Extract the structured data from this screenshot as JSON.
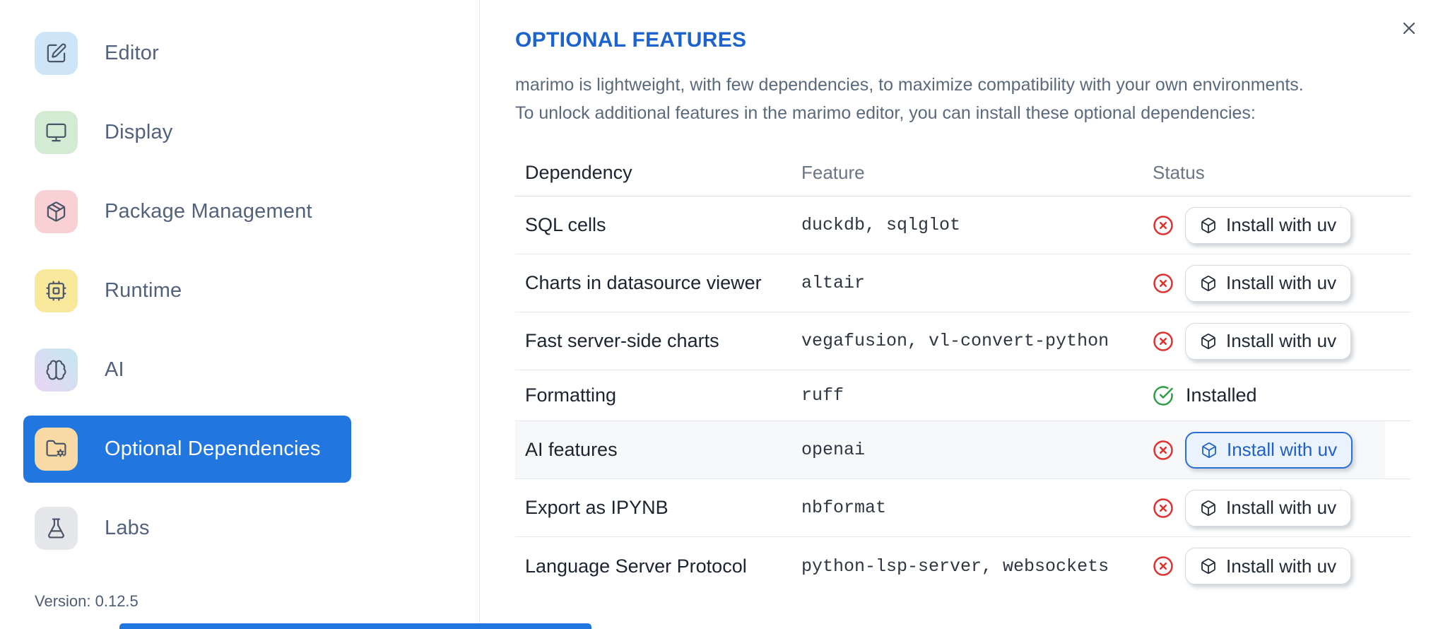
{
  "sidebar": {
    "items": [
      {
        "label": "Editor",
        "icon": "square-pen-icon",
        "icon_bg": "#cde5f7",
        "selected": false
      },
      {
        "label": "Display",
        "icon": "monitor-icon",
        "icon_bg": "#d3ebd3",
        "selected": false
      },
      {
        "label": "Package Management",
        "icon": "package-icon",
        "icon_bg": "#f9d0d3",
        "selected": false
      },
      {
        "label": "Runtime",
        "icon": "cpu-icon",
        "icon_bg": "#f8e89c",
        "selected": false
      },
      {
        "label": "AI",
        "icon": "brain-icon",
        "icon_bg": "linear-gradient(45deg, #ead4f5, #c4e8ee)",
        "selected": false
      },
      {
        "label": "Optional Dependencies",
        "icon": "folder-cog-icon",
        "icon_bg": "#f9d9a4",
        "selected": true
      },
      {
        "label": "Labs",
        "icon": "flask-icon",
        "icon_bg": "#e6e7eb",
        "selected": false
      }
    ],
    "selected_bg": "#2176e0",
    "version_label": "Version: 0.12.5"
  },
  "dialog": {
    "title": "OPTIONAL FEATURES",
    "title_color": "#1c63ce",
    "description_line1": "marimo is lightweight, with few dependencies, to maximize compatibility with your own environments.",
    "description_line2": "To unlock additional features in the marimo editor, you can install these optional dependencies:"
  },
  "table": {
    "columns": [
      "Dependency",
      "Feature",
      "Status"
    ],
    "install_button_label": "Install with uv",
    "installed_label": "Installed",
    "status_colors": {
      "missing": "#e03131",
      "installed": "#2f9e44"
    },
    "rows": [
      {
        "dependency": "SQL cells",
        "feature": "duckdb, sqlglot",
        "status": "missing"
      },
      {
        "dependency": "Charts in datasource viewer",
        "feature": "altair",
        "status": "missing"
      },
      {
        "dependency": "Fast server-side charts",
        "feature": "vegafusion, vl-convert-python",
        "status": "missing"
      },
      {
        "dependency": "Formatting",
        "feature": "ruff",
        "status": "installed"
      },
      {
        "dependency": "AI features",
        "feature": "openai",
        "status": "missing",
        "highlighted": true
      },
      {
        "dependency": "Export as IPYNB",
        "feature": "nbformat",
        "status": "missing"
      },
      {
        "dependency": "Language Server Protocol",
        "feature": "python-lsp-server, websockets",
        "status": "missing"
      }
    ]
  }
}
